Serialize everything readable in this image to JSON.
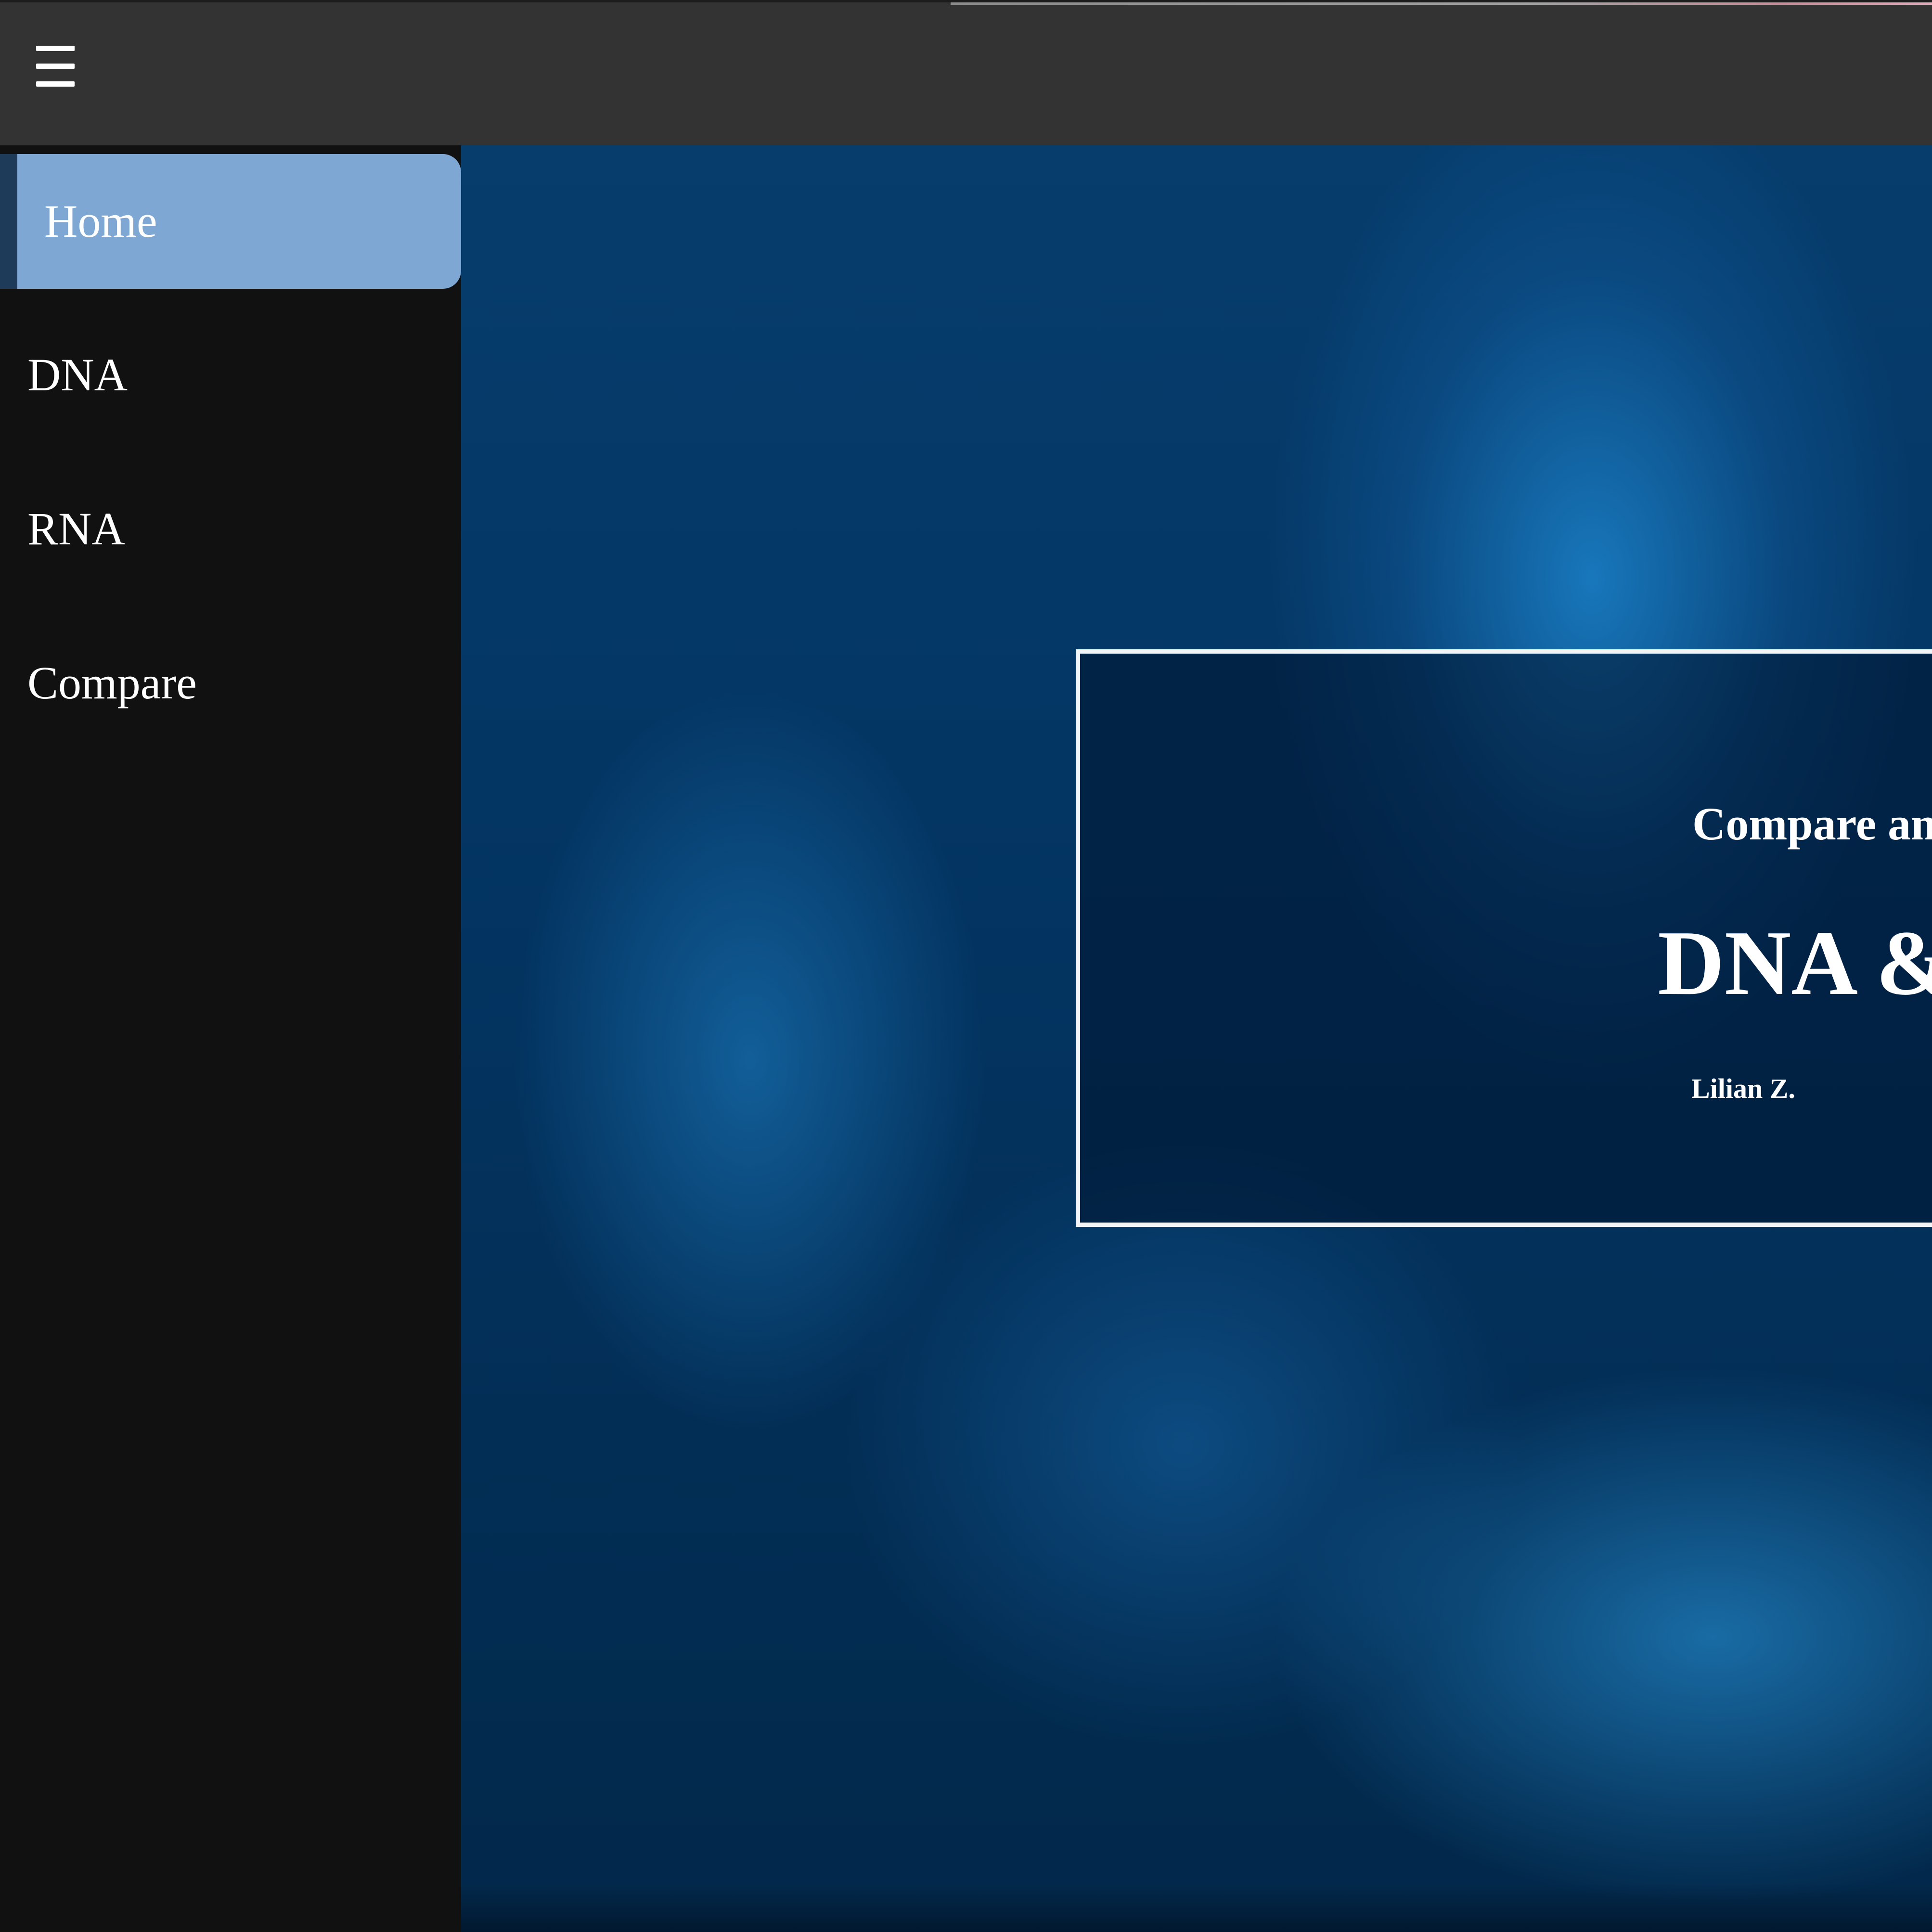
{
  "header": {
    "menu_icon": "hamburger-menu-icon"
  },
  "sidebar": {
    "items": [
      {
        "label": "Home",
        "active": true
      },
      {
        "label": "DNA",
        "active": false
      },
      {
        "label": "RNA",
        "active": false
      },
      {
        "label": "Compare",
        "active": false
      }
    ]
  },
  "hero": {
    "subtitle": "Compare and Contra",
    "title": "DNA & RN",
    "author": "Lilian Z."
  },
  "colors": {
    "topbar": "#333333",
    "sidebar": "#111111",
    "active_item": "#7ea7d3",
    "hero_blue": "#033461",
    "text": "#ffffff"
  }
}
